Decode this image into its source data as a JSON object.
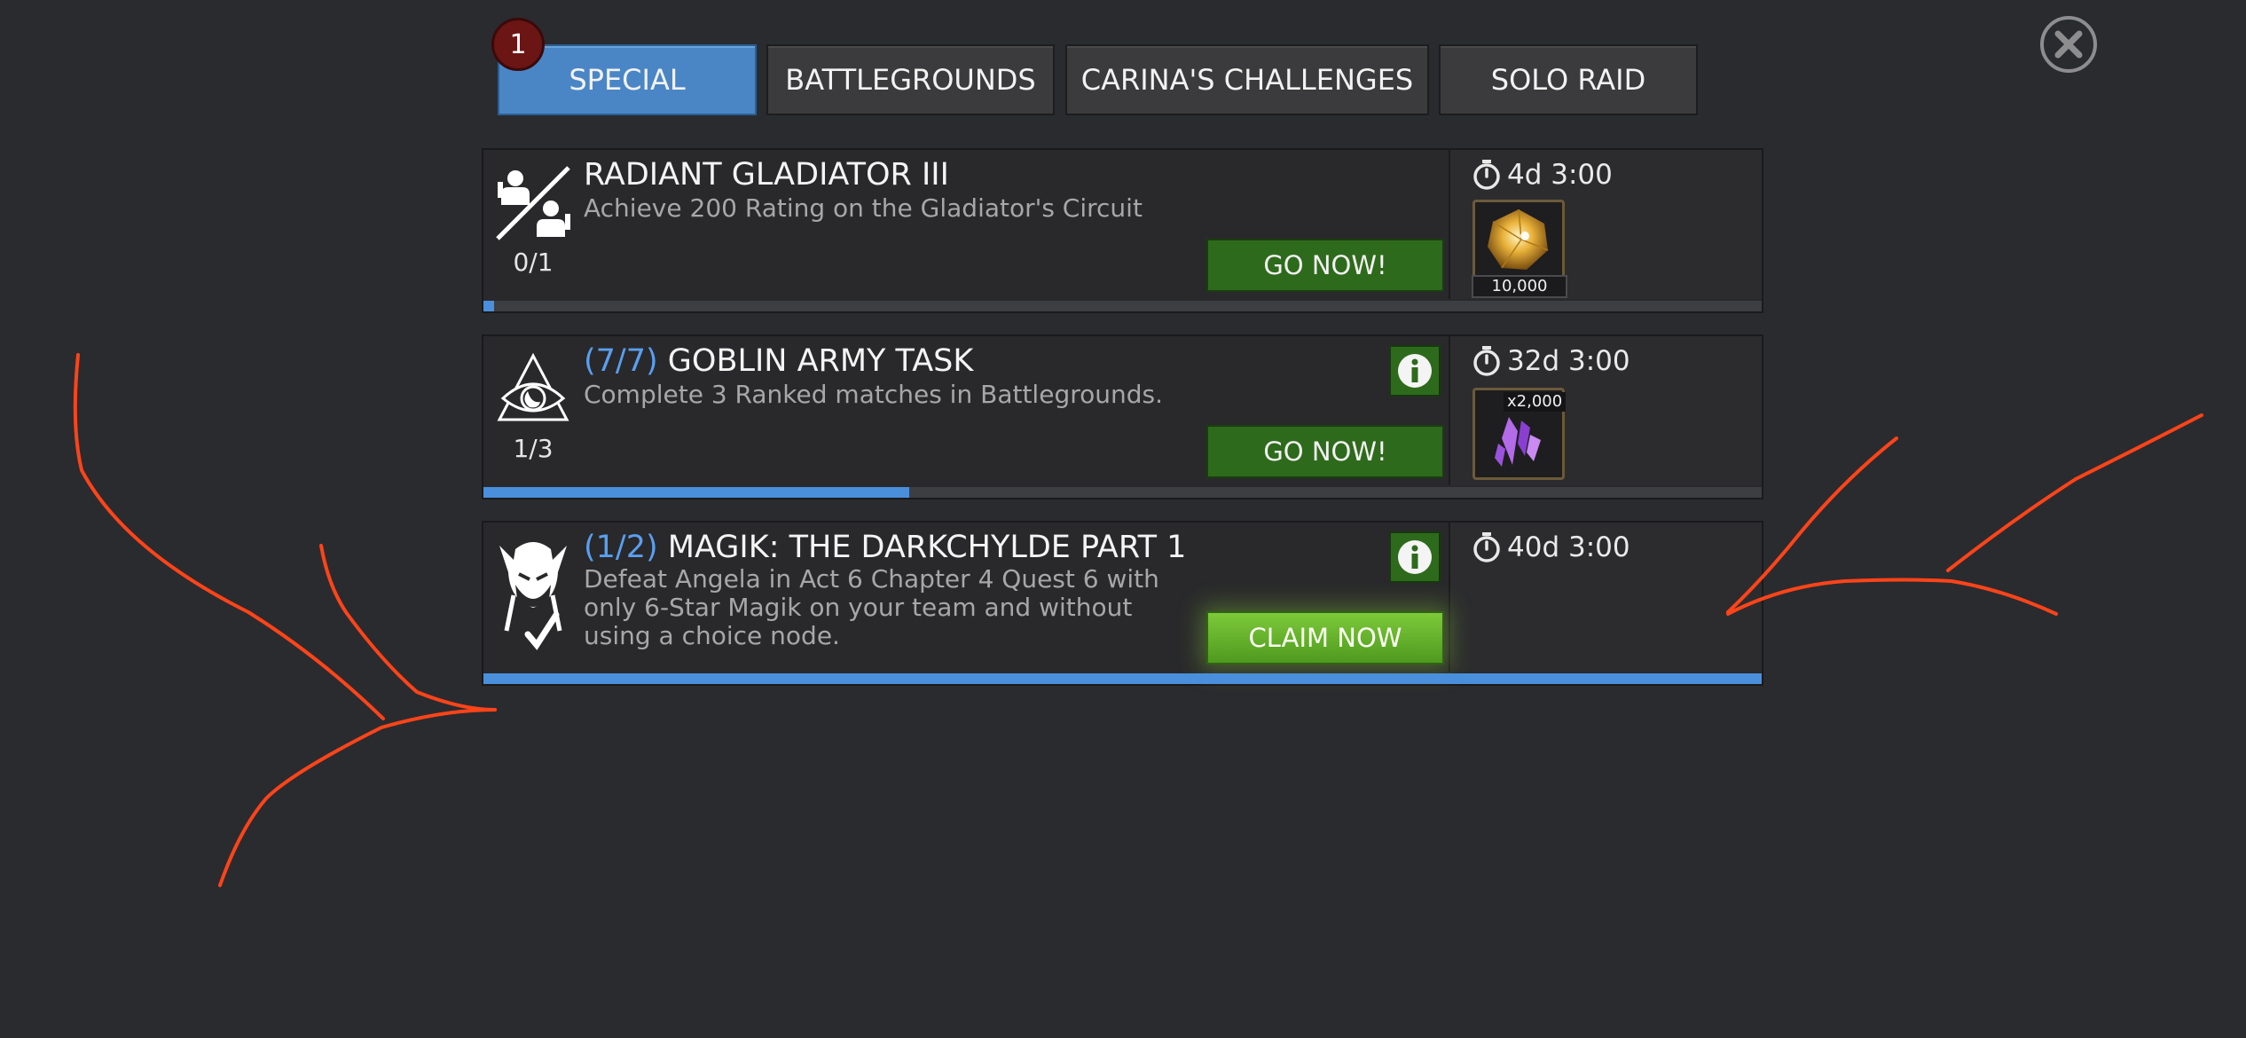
{
  "tabs": [
    {
      "label": "SPECIAL",
      "active": true
    },
    {
      "label": "BATTLEGROUNDS",
      "active": false
    },
    {
      "label": "CARINA'S CHALLENGES",
      "active": false
    },
    {
      "label": "SOLO RAID",
      "active": false
    }
  ],
  "tab_badge": "1",
  "close_icon": "close-icon",
  "quests": [
    {
      "icon": "gladiator-icon",
      "title": "RADIANT GLADIATOR III",
      "step": "",
      "description": "Achieve 200 Rating on the Gladiator's Circuit",
      "count": "0/1",
      "progress": 0.0,
      "button": "GO NOW!",
      "has_info": false,
      "timer": "4d 3:00",
      "reward": {
        "icon": "gold-crystal-icon",
        "label": "10,000"
      }
    },
    {
      "icon": "eye-pyramid-icon",
      "title": "GOBLIN ARMY TASK",
      "step": "(7/7)",
      "description": "Complete 3 Ranked matches in Battlegrounds.",
      "count": "1/3",
      "progress": 0.333,
      "button": "GO NOW!",
      "has_info": true,
      "timer": "32d 3:00",
      "reward": {
        "icon": "purple-shards-icon",
        "label": "x2,000"
      }
    },
    {
      "icon": "magik-head-check-icon",
      "title": "MAGIK: THE DARKCHYLDE PART 1",
      "step": "(1/2)",
      "description": "Defeat Angela in Act 6 Chapter 4 Quest 6 with only 6-Star Magik on your team and without using a choice node.",
      "count": "",
      "progress": 1.0,
      "button": "CLAIM NOW",
      "has_info": true,
      "timer": "40d 3:00",
      "reward": null
    }
  ],
  "colors": {
    "background": "#2a2b2f",
    "active_tab": "#4a86c5",
    "progress": "#4a8fdc",
    "go_button": "#2e6a1c",
    "claim_button": "#6bb92e",
    "annotation": "#ff4419",
    "step_text": "#5a9ff0"
  }
}
